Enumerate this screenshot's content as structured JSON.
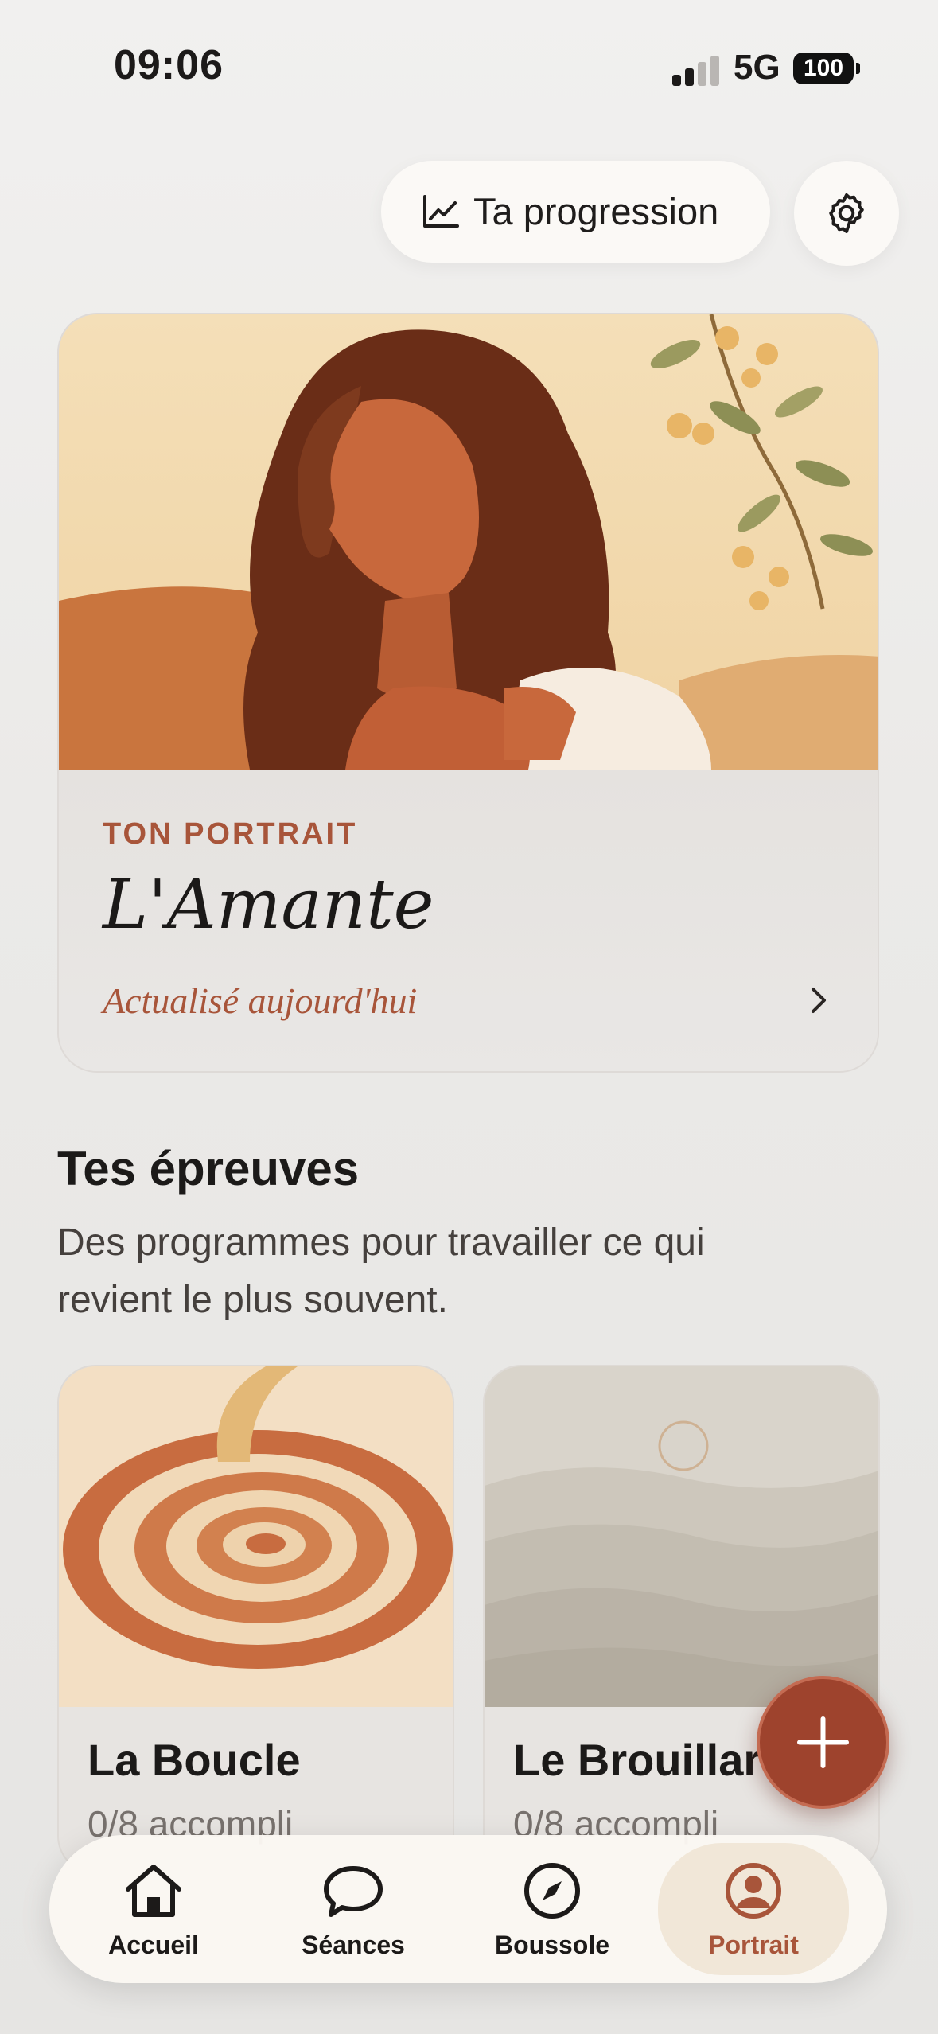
{
  "status_bar": {
    "time": "09:06",
    "network": "5G",
    "battery": "100"
  },
  "header": {
    "progress_label": "Ta progression",
    "progress_icon": "trend-chart-icon",
    "settings_icon": "gear-icon"
  },
  "portrait": {
    "eyebrow": "TON PORTRAIT",
    "title": "L'Amante",
    "updated": "Actualisé aujourd'hui"
  },
  "epreuves": {
    "title": "Tes épreuves",
    "description": "Des programmes pour travailler ce qui revient le plus souvent.",
    "cards": [
      {
        "name": "La Boucle",
        "progress": "0/8 accompli"
      },
      {
        "name": "Le Brouillard",
        "progress": "0/8 accompli"
      }
    ]
  },
  "fab": {
    "icon": "plus-icon"
  },
  "tabbar": {
    "items": [
      {
        "label": "Accueil",
        "icon": "home-icon"
      },
      {
        "label": "Séances",
        "icon": "chat-bubble-icon"
      },
      {
        "label": "Boussole",
        "icon": "compass-icon"
      },
      {
        "label": "Portrait",
        "icon": "user-circle-icon"
      }
    ],
    "active": "Portrait"
  },
  "colors": {
    "accent": "#a8553a",
    "fab": "#9e432d",
    "background": "#ecebe9"
  }
}
